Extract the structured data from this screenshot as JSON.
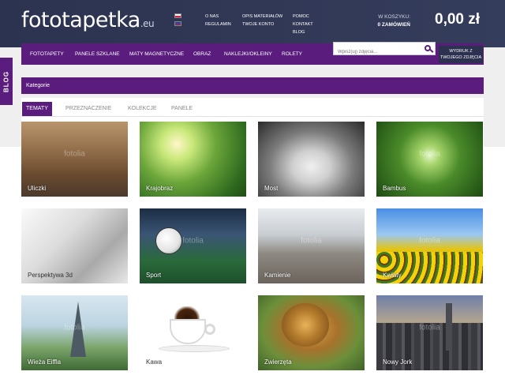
{
  "header": {
    "logo_main": "fototapetka",
    "logo_tld": ".eu",
    "links_col1": [
      "O NAS",
      "REGULAMIN"
    ],
    "links_col2": [
      "OPIS MATERIAŁÓW",
      "TWOJE KONTO"
    ],
    "links_col3": [
      "POMOC",
      "KONTAKT",
      "BLOG"
    ],
    "cart_label": "W KOSZYKU:",
    "cart_orders": "0 ZAMÓWIEŃ",
    "cart_value": "0,00 zł"
  },
  "nav": {
    "items": [
      "FOTOTAPETY",
      "PANELE SZKLANE",
      "MATY MAGNETYCZNE",
      "OBRAZ",
      "NAKLEJKI/OKLEINY",
      "ROLETY"
    ],
    "search_placeholder": "Wpisz(uj) zdjęcia...",
    "photo_button": "WYDRUK Z TWOJEGO ZDJĘCIA"
  },
  "blog_tab": "BLOG",
  "categories": {
    "title": "Kategorie",
    "tabs": [
      "TEMATY",
      "PRZEZNACZENIE",
      "KOLEKCJE",
      "PANELE"
    ],
    "active_tab": "TEMATY"
  },
  "tiles": [
    {
      "label": "Uliczki"
    },
    {
      "label": "Krajobraz"
    },
    {
      "label": "Most"
    },
    {
      "label": "Bambus"
    },
    {
      "label": "Perspektywa 3d"
    },
    {
      "label": "Sport"
    },
    {
      "label": "Kamienie"
    },
    {
      "label": "Kwiaty"
    },
    {
      "label": "Wieża Eiffla"
    },
    {
      "label": "Kawa"
    },
    {
      "label": "Zwierzęta"
    },
    {
      "label": "Nowy Jork"
    }
  ],
  "watermark": "fotolia",
  "colors": {
    "header_bg": "#2c3350",
    "accent_purple": "#5a1d7d",
    "page_bg": "#efefef"
  }
}
